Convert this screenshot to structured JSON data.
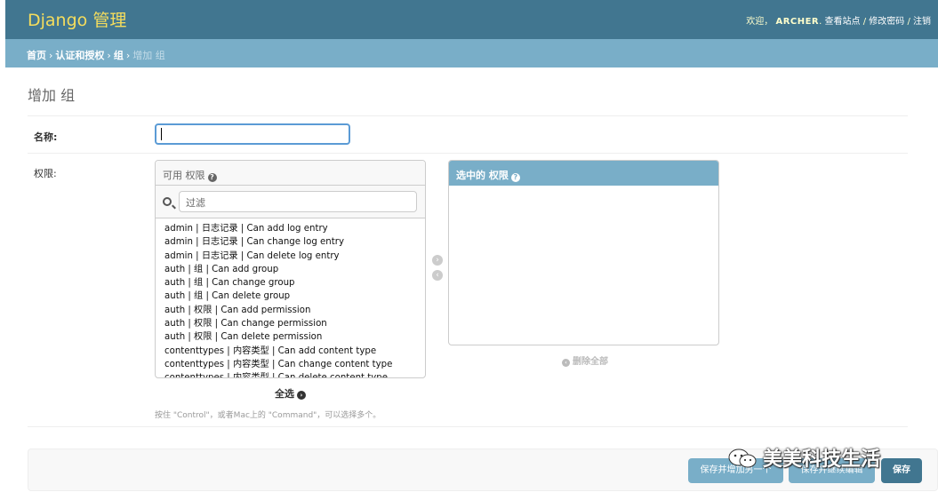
{
  "header": {
    "brand": "Django 管理",
    "welcome": "欢迎，",
    "username": "ARCHER",
    "view_site": "查看站点",
    "sep1": "/",
    "change_password": "修改密码",
    "sep2": "/",
    "logout": "注销"
  },
  "breadcrumbs": {
    "home": "首页",
    "app": "认证和授权",
    "model": "组",
    "current": "增加 组",
    "separator": "›"
  },
  "page_title": "增加 组",
  "form": {
    "name_label": "名称:",
    "name_value": "",
    "permissions_label": "权限:",
    "available": {
      "title": "可用 权限",
      "help_icon": "question-icon",
      "filter_placeholder": "过滤",
      "options": [
        "admin | 日志记录 | Can add log entry",
        "admin | 日志记录 | Can change log entry",
        "admin | 日志记录 | Can delete log entry",
        "auth | 组 | Can add group",
        "auth | 组 | Can change group",
        "auth | 组 | Can delete group",
        "auth | 权限 | Can add permission",
        "auth | 权限 | Can change permission",
        "auth | 权限 | Can delete permission",
        "contenttypes | 内容类型 | Can add content type",
        "contenttypes | 内容类型 | Can change content type",
        "contenttypes | 内容类型 | Can delete content type"
      ],
      "choose_all": "全选"
    },
    "chosen": {
      "title": "选中的 权限",
      "help_icon": "question-icon",
      "clear_all": "删除全部"
    },
    "help_text": "按住 \"Control\"，或者Mac上的 \"Command\"，可以选择多个。"
  },
  "submit": {
    "save_add_another": "保存并增加另一个",
    "save_continue": "保存并继续编辑",
    "save": "保存"
  },
  "watermark": "美美科技生活",
  "colors": {
    "header_bg": "#417690",
    "brand": "#f5dd5d",
    "breadcrumb_bg": "#79aec8",
    "primary_button": "#417690",
    "secondary_button": "#79aec8"
  }
}
